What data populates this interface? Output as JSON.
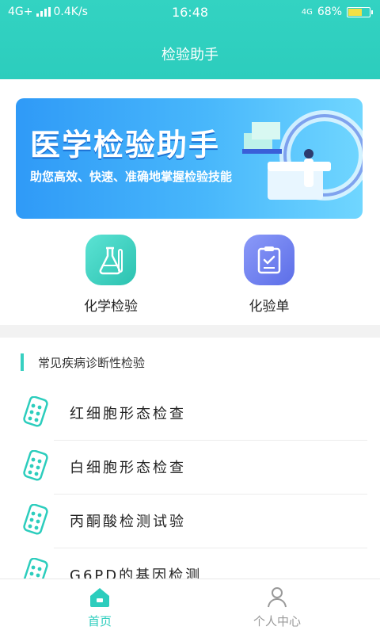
{
  "status_bar": {
    "network": "4G+",
    "speed": "0.4K/s",
    "time": "16:48",
    "network_right": "4G",
    "battery": "68%"
  },
  "header": {
    "title": "检验助手"
  },
  "banner": {
    "title": "医学检验助手",
    "subtitle": "助您高效、快速、准确地掌握检验技能"
  },
  "entries": [
    {
      "label": "化学检验",
      "icon": "flask-icon",
      "color": "#2bc7b3"
    },
    {
      "label": "化验单",
      "icon": "clipboard-check-icon",
      "color": "#6b7cf0"
    }
  ],
  "section": {
    "title": "常见疾病诊断性检验"
  },
  "list": [
    {
      "label": "红细胞形态检查"
    },
    {
      "label": "白细胞形态检查"
    },
    {
      "label": "丙酮酸检测试验"
    },
    {
      "label": "G6PD的基因检测"
    }
  ],
  "nav": [
    {
      "label": "首页",
      "icon": "home-icon",
      "active": true
    },
    {
      "label": "个人中心",
      "icon": "user-icon",
      "active": false
    }
  ],
  "colors": {
    "accent": "#33d3c2",
    "active": "#2ccdbd",
    "inactive": "#999999"
  }
}
